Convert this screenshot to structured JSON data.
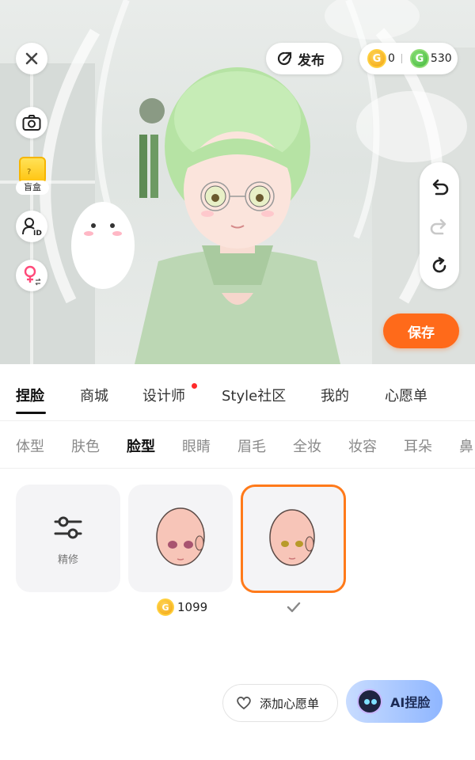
{
  "header": {
    "publish_label": "发布",
    "currency_gold": "0",
    "currency_green": "530",
    "gold_coin_glyph": "G",
    "green_coin_glyph": "G"
  },
  "left_tools": {
    "blindbox_label": "盲盒"
  },
  "history": {
    "undo_icon": "undo-icon",
    "redo_icon": "redo-icon",
    "reset_icon": "refresh-icon"
  },
  "save_label": "保存",
  "main_tabs": [
    {
      "label": "捏脸",
      "active": true
    },
    {
      "label": "商城",
      "active": false
    },
    {
      "label": "设计师",
      "active": false,
      "badge": true
    },
    {
      "label": "Style社区",
      "active": false
    },
    {
      "label": "我的",
      "active": false
    },
    {
      "label": "心愿单",
      "active": false
    }
  ],
  "sub_tabs": [
    {
      "label": "体型",
      "active": false
    },
    {
      "label": "肤色",
      "active": false
    },
    {
      "label": "脸型",
      "active": true
    },
    {
      "label": "眼睛",
      "active": false
    },
    {
      "label": "眉毛",
      "active": false
    },
    {
      "label": "全妆",
      "active": false
    },
    {
      "label": "妆容",
      "active": false
    },
    {
      "label": "耳朵",
      "active": false
    },
    {
      "label": "鼻",
      "active": false
    }
  ],
  "cards": {
    "refine_label": "精修",
    "face1_price": "1099",
    "face2_selected": true
  },
  "bottom": {
    "wish_label": "添加心愿单",
    "ai_label": "AI捏脸"
  },
  "colors": {
    "accent_orange": "#ff6a1a",
    "selected_border": "#ff7a1a",
    "badge_red": "#ff2a2a",
    "ai_button_start": "#c8dcff",
    "ai_button_end": "#8fb6ff"
  }
}
